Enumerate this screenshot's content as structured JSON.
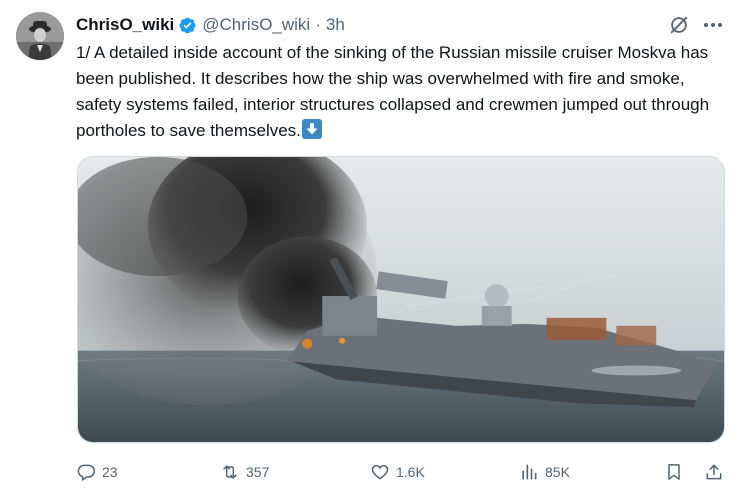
{
  "tweet": {
    "author_name": "ChrisO_wiki",
    "author_handle": "@ChrisO_wiki",
    "separator": "·",
    "time": "3h",
    "text": "1/ A detailed inside account of the sinking of the Russian missile cruiser Moskva has been published. It describes how the ship was overwhelmed with fire and smoke, safety systems failed, interior structures collapsed and crewmen jumped out through portholes to save themselves.",
    "emoji": "down-arrow-emoji",
    "verified": true,
    "accent_color": "#1d9bf0"
  },
  "media": {
    "type": "photo",
    "subject": "damaged-warship-smoke"
  },
  "actions": {
    "replies": "23",
    "reposts": "357",
    "likes": "1.6K",
    "views": "85K"
  },
  "icons": {
    "reply": "reply-icon",
    "repost": "repost-icon",
    "like": "heart-icon",
    "views": "views-icon",
    "bookmark": "bookmark-icon",
    "share": "share-icon",
    "grok": "grok-icon",
    "more": "more-icon",
    "verified": "verified-badge-icon"
  }
}
